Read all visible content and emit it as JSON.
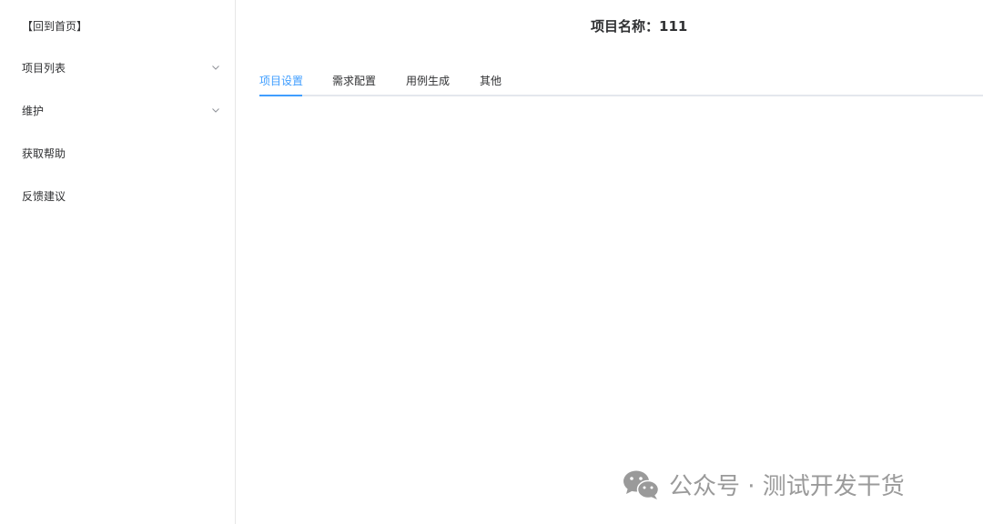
{
  "sidebar": {
    "home_link": "【回到首页】",
    "items": [
      {
        "label": "项目列表",
        "has_submenu": true
      },
      {
        "label": "维护",
        "has_submenu": true
      },
      {
        "label": "获取帮助",
        "has_submenu": false
      },
      {
        "label": "反馈建议",
        "has_submenu": false
      }
    ]
  },
  "header": {
    "title": "项目名称：111"
  },
  "tabs": [
    {
      "label": "项目设置",
      "active": true
    },
    {
      "label": "需求配置",
      "active": false
    },
    {
      "label": "用例生成",
      "active": false
    },
    {
      "label": "其他",
      "active": false
    }
  ],
  "watermark": {
    "text": "公众号 · 测试开发干货",
    "icon": "wechat-logo"
  },
  "colors": {
    "accent": "#409eff",
    "text": "#303133",
    "border": "#e6e6e6",
    "watermark": "#9a9a9a"
  }
}
